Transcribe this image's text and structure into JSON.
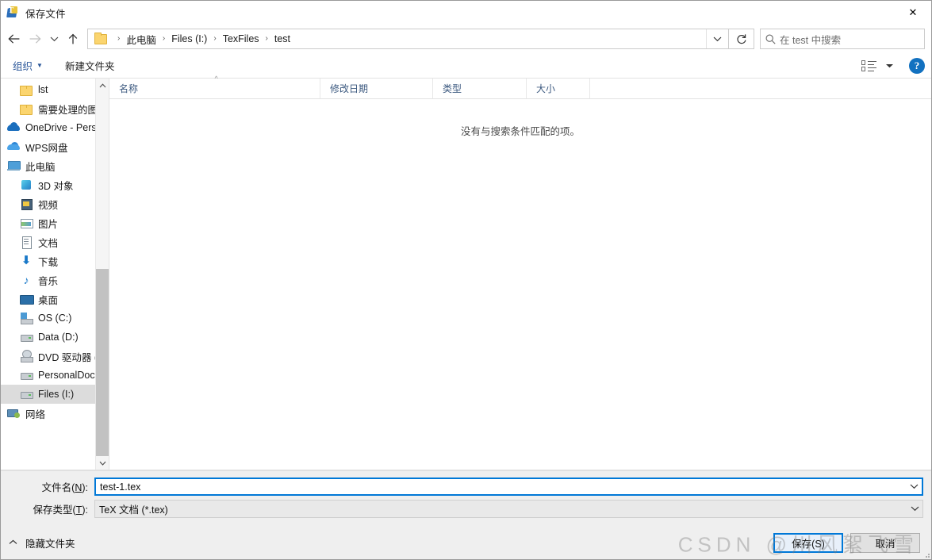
{
  "window": {
    "title": "保存文件",
    "icon": "texstudio-icon",
    "close_label": "✕"
  },
  "nav": {
    "back_icon": "arrow-left-icon",
    "forward_icon": "arrow-right-icon",
    "recent_icon": "chevron-down-icon",
    "up_icon": "arrow-up-icon",
    "breadcrumb": [
      "此电脑",
      "Files (I:)",
      "TexFiles",
      "test"
    ],
    "breadcrumb_separator": "›",
    "address_chevron": "⌄",
    "refresh_icon": "↻",
    "search_icon": "search-icon",
    "search_placeholder": "在 test 中搜索"
  },
  "toolbar": {
    "organize_label": "组织",
    "organize_caret": "▼",
    "new_folder_label": "新建文件夹",
    "view_icon": "list-view-icon",
    "view_caret": "▼",
    "help_label": "?"
  },
  "sidebar": {
    "items": [
      {
        "label": "lst",
        "icon": "folder-icon",
        "indent": 1,
        "selected": false
      },
      {
        "label": "需要处理的图",
        "icon": "folder-icon",
        "indent": 1,
        "selected": false
      },
      {
        "label": "OneDrive - Personal",
        "icon": "onedrive-cloud-icon",
        "indent": 0,
        "selected": false
      },
      {
        "label": "WPS网盘",
        "icon": "wps-cloud-icon",
        "indent": 0,
        "selected": false
      },
      {
        "label": "此电脑",
        "icon": "this-pc-icon",
        "indent": 0,
        "selected": false
      },
      {
        "label": "3D 对象",
        "icon": "3d-objects-icon",
        "indent": 1,
        "selected": false
      },
      {
        "label": "视频",
        "icon": "videos-icon",
        "indent": 1,
        "selected": false
      },
      {
        "label": "图片",
        "icon": "pictures-icon",
        "indent": 1,
        "selected": false
      },
      {
        "label": "文档",
        "icon": "documents-icon",
        "indent": 1,
        "selected": false
      },
      {
        "label": "下载",
        "icon": "downloads-icon",
        "indent": 1,
        "selected": false
      },
      {
        "label": "音乐",
        "icon": "music-icon",
        "indent": 1,
        "selected": false
      },
      {
        "label": "桌面",
        "icon": "desktop-icon",
        "indent": 1,
        "selected": false
      },
      {
        "label": "OS (C:)",
        "icon": "os-drive-icon",
        "indent": 1,
        "selected": false
      },
      {
        "label": "Data (D:)",
        "icon": "drive-icon",
        "indent": 1,
        "selected": false
      },
      {
        "label": "DVD 驱动器 (E:)",
        "icon": "dvd-drive-icon",
        "indent": 1,
        "selected": false
      },
      {
        "label": "PersonalDoc (F:)",
        "icon": "drive-icon",
        "indent": 1,
        "selected": false
      },
      {
        "label": "Files (I:)",
        "icon": "drive-icon",
        "indent": 1,
        "selected": true
      },
      {
        "label": "网络",
        "icon": "network-icon",
        "indent": 0,
        "selected": false
      }
    ],
    "scroll_up_icon": "▲",
    "scroll_down_icon": "▼"
  },
  "filelist": {
    "columns": [
      {
        "label": "名称",
        "sorted": true,
        "sort_caret": "^"
      },
      {
        "label": "修改日期",
        "sorted": false,
        "sort_caret": ""
      },
      {
        "label": "类型",
        "sorted": false,
        "sort_caret": ""
      },
      {
        "label": "大小",
        "sorted": false,
        "sort_caret": ""
      }
    ],
    "rows": [],
    "empty_message": "没有与搜索条件匹配的项。"
  },
  "form": {
    "filename_label_pre": "文件名(",
    "filename_label_key": "N",
    "filename_label_post": "):",
    "filename_value": "test-1.tex",
    "filetype_label_pre": "保存类型(",
    "filetype_label_key": "T",
    "filetype_label_post": "):",
    "filetype_value": "TeX 文档 (*.tex)",
    "dropdown_icon": "⌄"
  },
  "footer": {
    "hide_folders_label": "隐藏文件夹",
    "hide_folders_caret": "⌃",
    "save_label": "保存(S)",
    "cancel_label": "取消",
    "watermark": "CSDN @川风絮飞雪"
  },
  "colors": {
    "accent": "#0078d7",
    "selection": "#dcdcdc",
    "breadcrumb_text": "#1a1a1a",
    "toolbar_link": "#2a5699",
    "column_header": "#3d5a80",
    "chrome_bg": "#efefef"
  }
}
